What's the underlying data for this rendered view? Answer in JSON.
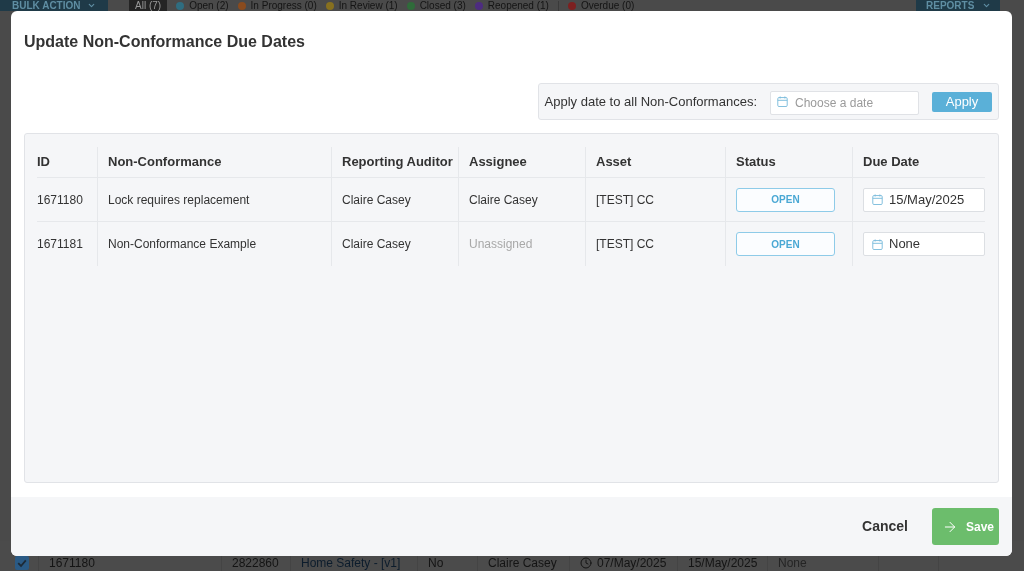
{
  "background_page": {
    "top_bar": {
      "bulk_action": "BULK ACTION",
      "filters": [
        {
          "label": "All (7)",
          "selected": true
        },
        {
          "label": "Open (2)",
          "selected": false,
          "color": "#2f6d80"
        },
        {
          "label": "In Progress (0)",
          "selected": false,
          "color": "#8a4b1e"
        },
        {
          "label": "In Review (1)",
          "selected": false,
          "color": "#87701f"
        },
        {
          "label": "Closed (3)",
          "selected": false,
          "color": "#2f6b3a"
        },
        {
          "label": "Reopened (1)",
          "selected": false,
          "color": "#4d2c80"
        },
        {
          "label": "Overdue (0)",
          "selected": false,
          "color": "#7d2020"
        }
      ],
      "reports": "REPORTS"
    },
    "row": {
      "checked": true,
      "cells": [
        {
          "kind": "text",
          "text": "1671180"
        },
        {
          "kind": "text",
          "text": "2822860"
        },
        {
          "kind": "link",
          "text": "Home Safety - [v1]"
        },
        {
          "kind": "text",
          "text": "No"
        },
        {
          "kind": "text",
          "text": "Claire Casey"
        },
        {
          "kind": "date",
          "text": "07/May/2025"
        },
        {
          "kind": "text",
          "text": "15/May/2025"
        },
        {
          "kind": "muted",
          "text": "None"
        }
      ]
    }
  },
  "dialog": {
    "title": "Update Non-Conformance Due Dates",
    "apply_bar": {
      "label": "Apply date to all Non-Conformances:",
      "date_field": {
        "placeholder": "Choose a date"
      },
      "button": "Apply"
    },
    "table": {
      "columns": [
        "ID",
        "Non-Conformance",
        "Reporting Auditor",
        "Assignee",
        "Asset",
        "Status",
        "Due Date"
      ],
      "rows": [
        {
          "id": "1671180",
          "non_conformance": "Lock requires replacement",
          "reporting_auditor": "Claire Casey",
          "assignee": "Claire Casey",
          "assigned": true,
          "asset": "[TEST] CC",
          "status": "OPEN",
          "due_date": "15/May/2025"
        },
        {
          "id": "1671181",
          "non_conformance": "Non-Conformance Example",
          "reporting_auditor": "Claire Casey",
          "assignee": "Unassigned",
          "assigned": false,
          "asset": "[TEST] CC",
          "status": "OPEN",
          "due_date": "None"
        }
      ]
    },
    "footer": {
      "cancel": "Cancel",
      "save": "Save"
    }
  }
}
